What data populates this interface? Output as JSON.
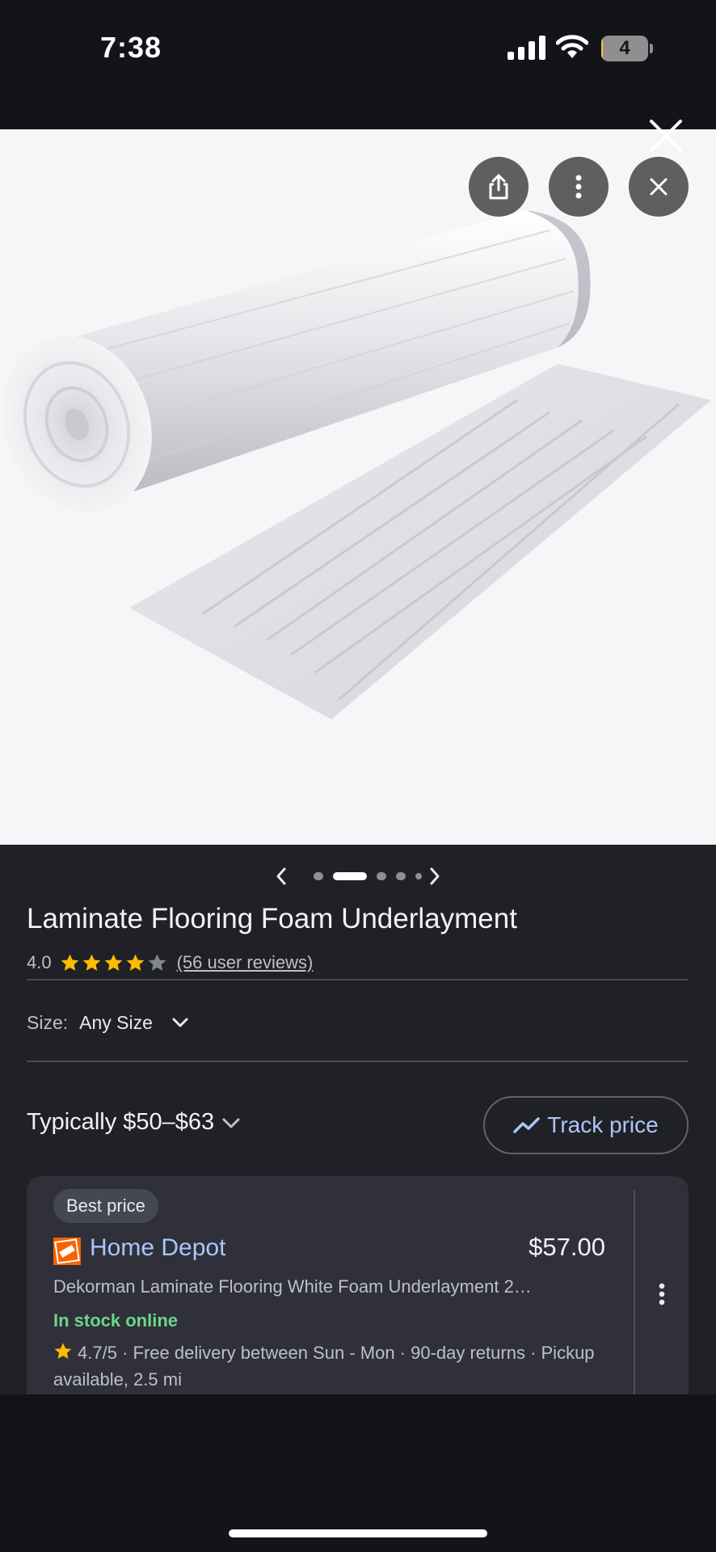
{
  "status_bar": {
    "time": "7:38",
    "battery_level": "4",
    "battery_fraction": 0.04
  },
  "image_toolbar": {
    "icons": [
      "share-icon",
      "more-vert-icon",
      "close-icon"
    ]
  },
  "carousel": {
    "total": 5,
    "active_index": 1
  },
  "product": {
    "title": "Laminate Flooring Foam Underlayment",
    "rating_value": "4.0",
    "rating": 4,
    "rating_max": 5,
    "reviews_text": "(56 user reviews)"
  },
  "size": {
    "label": "Size:",
    "value": "Any Size"
  },
  "price": {
    "typical_range": "Typically $50–$63",
    "track_label": "Track price"
  },
  "offer": {
    "badge": "Best price",
    "store": "Home Depot",
    "store_logo_text": "THE HOME DEPOT",
    "price": "$57.00",
    "description": "Dekorman Laminate Flooring White Foam Underlayment 2…",
    "stock": "In stock online",
    "store_rating": "4.7/5",
    "details": "· Free delivery between Sun - Mon · 90-day returns · Pickup available, 2.5 mi"
  },
  "colors": {
    "accent_link": "#a8c7fa",
    "star": "#fbbc04",
    "in_stock": "#6dd58c",
    "home_depot_orange": "#f96302"
  }
}
